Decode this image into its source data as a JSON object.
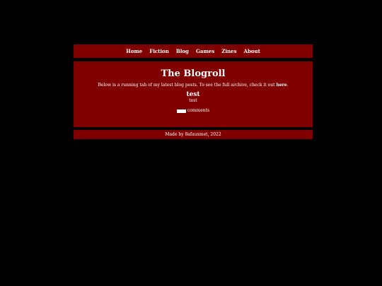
{
  "nav": {
    "items": [
      "Home",
      "Fiction",
      "Blog",
      "Games",
      "Zines",
      "About"
    ]
  },
  "main": {
    "title": "The Blogroll",
    "intro_text": "Below is a running tab of my latest blog posts. To see the full archive, check it out ",
    "intro_link": "here",
    "intro_end": ".",
    "post": {
      "title": "test",
      "body": "test",
      "comments_label": "comments"
    }
  },
  "footer": {
    "text": "Made by 8afauxmet, 2022"
  },
  "colors": {
    "background": "#000000",
    "panel": "#800000",
    "text": "#ffffff"
  }
}
